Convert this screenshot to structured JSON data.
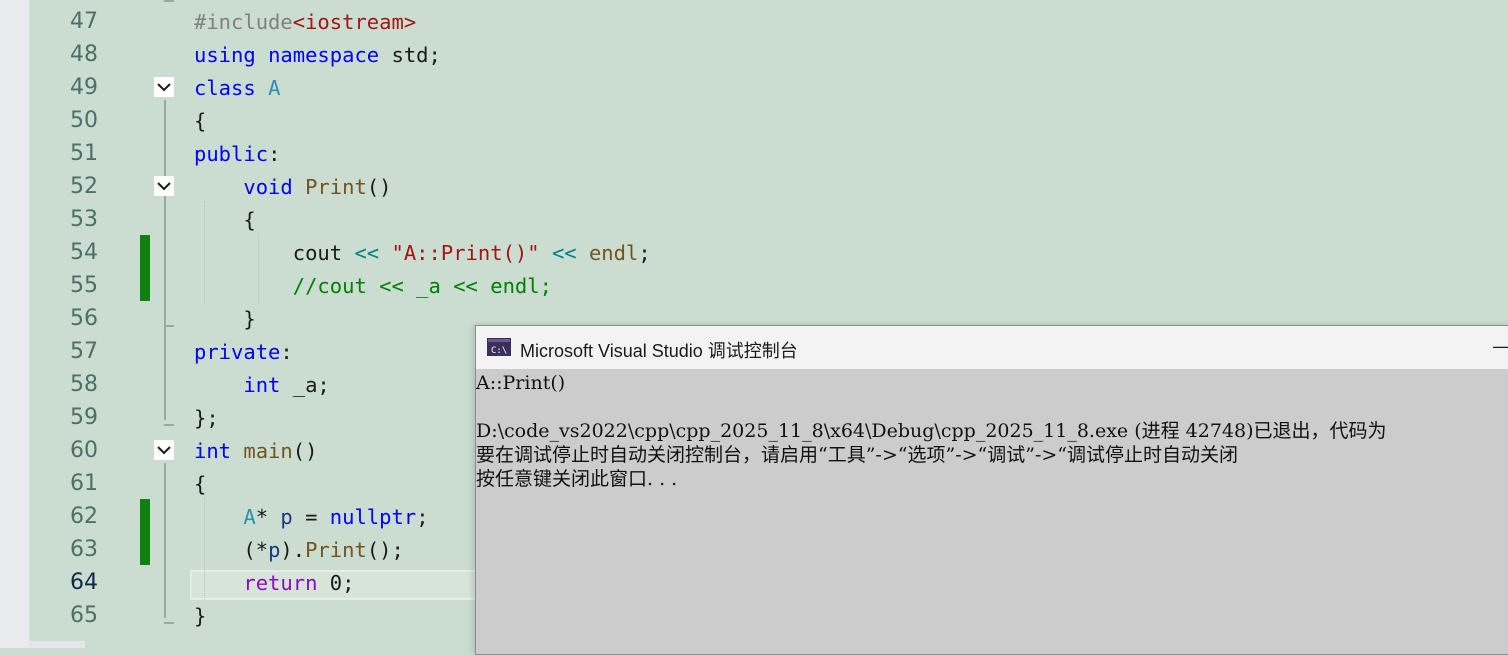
{
  "editor": {
    "lines": [
      {
        "num": "47",
        "segments": [
          [
            "pp",
            "#include"
          ],
          [
            "str",
            "<iostream>"
          ]
        ]
      },
      {
        "num": "48",
        "segments": [
          [
            "kw",
            "using"
          ],
          [
            "txt",
            " "
          ],
          [
            "kw",
            "namespace"
          ],
          [
            "txt",
            " std;"
          ]
        ]
      },
      {
        "num": "49",
        "segments": [
          [
            "kw",
            "class"
          ],
          [
            "txt",
            " "
          ],
          [
            "cls",
            "A"
          ]
        ]
      },
      {
        "num": "50",
        "segments": [
          [
            "txt",
            "{"
          ]
        ]
      },
      {
        "num": "51",
        "segments": [
          [
            "kw",
            "public"
          ],
          [
            "txt",
            ":"
          ]
        ]
      },
      {
        "num": "52",
        "segments": [
          [
            "txt",
            "    "
          ],
          [
            "kw",
            "void"
          ],
          [
            "txt",
            " "
          ],
          [
            "fn",
            "Print"
          ],
          [
            "txt",
            "()"
          ]
        ]
      },
      {
        "num": "53",
        "segments": [
          [
            "txt",
            "    {"
          ]
        ]
      },
      {
        "num": "54",
        "segments": [
          [
            "txt",
            "        cout "
          ],
          [
            "op",
            "<<"
          ],
          [
            "txt",
            " "
          ],
          [
            "str",
            "\"A::Print()\""
          ],
          [
            "txt",
            " "
          ],
          [
            "op",
            "<<"
          ],
          [
            "txt",
            " "
          ],
          [
            "fn",
            "endl"
          ],
          [
            "txt",
            ";"
          ]
        ]
      },
      {
        "num": "55",
        "segments": [
          [
            "txt",
            "        "
          ],
          [
            "cm",
            "//cout << _a << endl;"
          ]
        ]
      },
      {
        "num": "56",
        "segments": [
          [
            "txt",
            "    }"
          ]
        ]
      },
      {
        "num": "57",
        "segments": [
          [
            "kw",
            "private"
          ],
          [
            "txt",
            ":"
          ]
        ]
      },
      {
        "num": "58",
        "segments": [
          [
            "txt",
            "    "
          ],
          [
            "kw",
            "int"
          ],
          [
            "txt",
            " _a;"
          ]
        ]
      },
      {
        "num": "59",
        "segments": [
          [
            "txt",
            "};"
          ]
        ]
      },
      {
        "num": "60",
        "segments": [
          [
            "kw",
            "int"
          ],
          [
            "txt",
            " "
          ],
          [
            "fn",
            "main"
          ],
          [
            "txt",
            "()"
          ]
        ]
      },
      {
        "num": "61",
        "segments": [
          [
            "txt",
            "{"
          ]
        ]
      },
      {
        "num": "62",
        "segments": [
          [
            "txt",
            "    "
          ],
          [
            "cls",
            "A"
          ],
          [
            "txt",
            "* "
          ],
          [
            "var",
            "p"
          ],
          [
            "txt",
            " = "
          ],
          [
            "kw",
            "nullptr"
          ],
          [
            "txt",
            ";"
          ]
        ]
      },
      {
        "num": "63",
        "segments": [
          [
            "txt",
            "    (*"
          ],
          [
            "var",
            "p"
          ],
          [
            "txt",
            ")."
          ],
          [
            "fn",
            "Print"
          ],
          [
            "txt",
            "();"
          ]
        ]
      },
      {
        "num": "64",
        "segments": [
          [
            "txt",
            "    "
          ],
          [
            "ret",
            "return"
          ],
          [
            "txt",
            " 0;"
          ]
        ]
      },
      {
        "num": "65",
        "segments": [
          [
            "txt",
            "}"
          ]
        ]
      }
    ],
    "current_line": "64"
  },
  "console": {
    "title": "Microsoft Visual Studio 调试控制台",
    "icon": "console-app-icon",
    "minimize_label": "—",
    "output": [
      "A::Print()",
      "",
      "D:\\code_vs2022\\cpp\\cpp_2025_11_8\\x64\\Debug\\cpp_2025_11_8.exe (进程 42748)已退出，代码为",
      "要在调试停止时自动关闭控制台，请启用“工具”->“选项”->“调试”->“调试停止时自动关闭",
      "按任意键关闭此窗口. . ."
    ]
  },
  "colors": {
    "editor_bg": "#cbddd0",
    "keyword": "#0000ff",
    "class": "#2b91af",
    "function": "#74531f",
    "string": "#a31515",
    "comment": "#008000",
    "change_bar": "#108010",
    "console_bg": "#cccccc"
  }
}
